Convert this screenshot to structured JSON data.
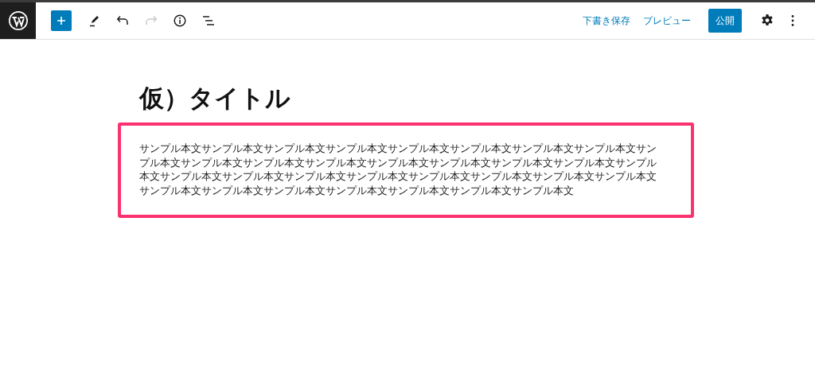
{
  "toolbar": {
    "tools": [
      {
        "kind": "add",
        "disabled": false
      },
      {
        "kind": "edit",
        "disabled": false
      },
      {
        "kind": "undo",
        "disabled": false
      },
      {
        "kind": "redo",
        "disabled": true
      },
      {
        "kind": "info",
        "disabled": false
      },
      {
        "kind": "outline",
        "disabled": false
      }
    ],
    "save_draft": "下書き保存",
    "preview": "プレビュー",
    "publish": "公開"
  },
  "post": {
    "title": "仮）タイトル",
    "body": "サンプル本文サンプル本文サンプル本文サンプル本文サンプル本文サンプル本文サンプル本文サンプル本文サンプル本文サンプル本文サンプル本文サンプル本文サンプル本文サンプル本文サンプル本文サンプル本文サンプル本文サンプル本文サンプル本文サンプル本文サンプル本文サンプル本文サンプル本文サンプル本文サンプル本文サンプル本文サンプル本文サンプル本文サンプル本文サンプル本文サンプル本文サンプル本文"
  }
}
